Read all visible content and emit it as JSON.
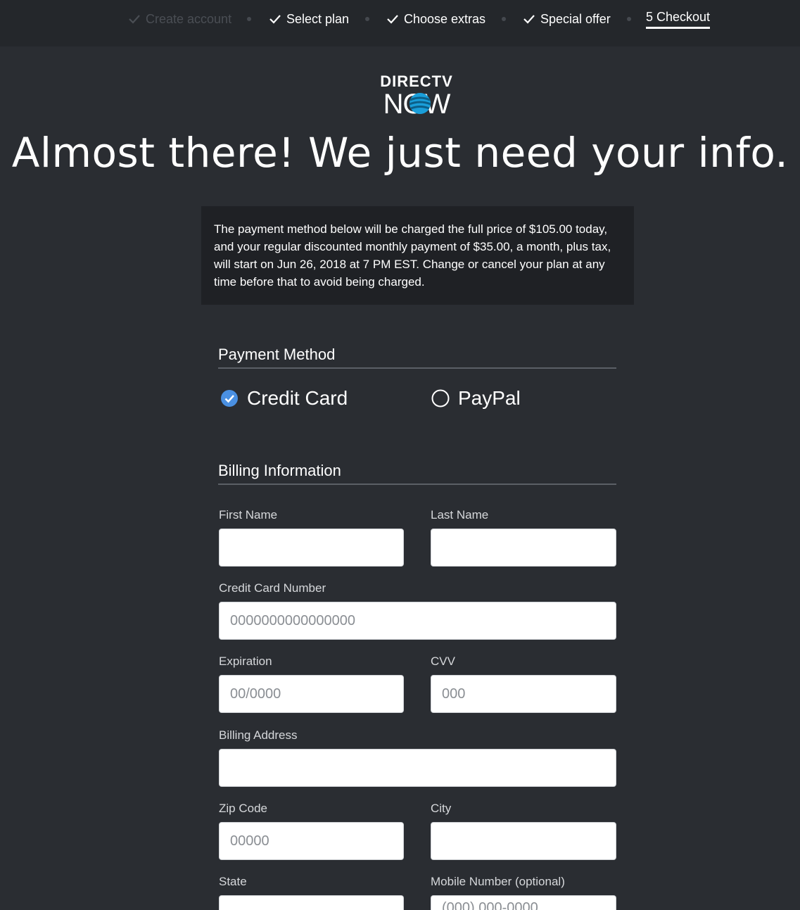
{
  "stepper": {
    "steps": [
      {
        "label": "Create account",
        "state": "muted"
      },
      {
        "label": "Select plan",
        "state": "done"
      },
      {
        "label": "Choose extras",
        "state": "done"
      },
      {
        "label": "Special offer",
        "state": "done"
      },
      {
        "label": "5 Checkout",
        "state": "active"
      }
    ]
  },
  "logo": {
    "top": "DIRECTV",
    "bottom": "NOW"
  },
  "headline": "Almost there! We just need your info.",
  "notice": "The payment method below will be charged the full price of $105.00 today, and your regular discounted monthly payment of $35.00, a month, plus tax, will start on Jun 26, 2018 at 7 PM EST. Change or cancel your plan at any time before that to avoid being charged.",
  "payment": {
    "title": "Payment Method",
    "options": [
      {
        "label": "Credit Card",
        "selected": true
      },
      {
        "label": "PayPal",
        "selected": false
      }
    ]
  },
  "billing": {
    "title": "Billing Information",
    "fields": {
      "first_name": {
        "label": "First Name",
        "value": "",
        "placeholder": ""
      },
      "last_name": {
        "label": "Last Name",
        "value": "",
        "placeholder": ""
      },
      "card_number": {
        "label": "Credit Card Number",
        "value": "",
        "placeholder": "0000000000000000"
      },
      "expiration": {
        "label": "Expiration",
        "value": "",
        "placeholder": "00/0000"
      },
      "cvv": {
        "label": "CVV",
        "value": "",
        "placeholder": "000"
      },
      "address": {
        "label": "Billing Address",
        "value": "",
        "placeholder": ""
      },
      "zip": {
        "label": "Zip Code",
        "value": "",
        "placeholder": "00000"
      },
      "city": {
        "label": "City",
        "value": "",
        "placeholder": ""
      },
      "state": {
        "label": "State",
        "value": "",
        "placeholder": ""
      },
      "mobile": {
        "label": "Mobile Number (optional)",
        "value": "",
        "placeholder": "(000) 000-0000"
      }
    }
  },
  "colors": {
    "background": "#2a2d32",
    "topbar": "#24272b",
    "notice_bg": "#1f2125",
    "accent": "#4a90e2"
  }
}
